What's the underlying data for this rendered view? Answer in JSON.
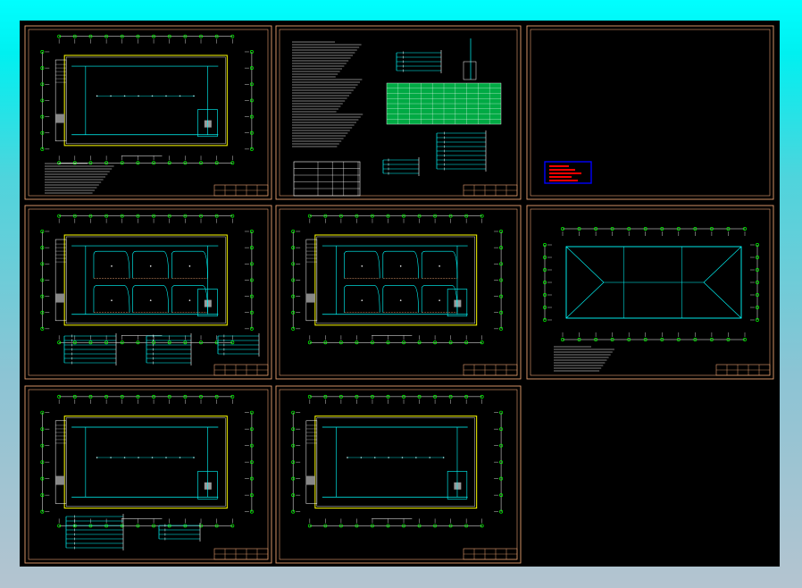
{
  "window": {
    "background_gradient": [
      "#00ffff",
      "#b4c4d0"
    ],
    "canvas_color": "#000000"
  },
  "sheets": [
    {
      "id": "sheet-1",
      "kind": "floor-plan"
    },
    {
      "id": "sheet-2",
      "kind": "notes-and-schedules"
    },
    {
      "id": "sheet-3",
      "kind": "cover"
    },
    {
      "id": "sheet-4",
      "kind": "floor-plan-with-systems"
    },
    {
      "id": "sheet-5",
      "kind": "floor-plan"
    },
    {
      "id": "sheet-6",
      "kind": "roof-plan"
    },
    {
      "id": "sheet-7",
      "kind": "floor-plan-with-systems"
    },
    {
      "id": "sheet-8",
      "kind": "floor-plan"
    }
  ],
  "colors": {
    "frame": "#e8a070",
    "grid_line": "#ffffff",
    "axis_bubble": "#00ff00",
    "wall": "#ffff00",
    "pipe": "#00ffff",
    "text": "#ffffff",
    "stamp_border": "#0000ff",
    "stamp_fill": "#ff0000",
    "table_fill": "#00aa44"
  }
}
